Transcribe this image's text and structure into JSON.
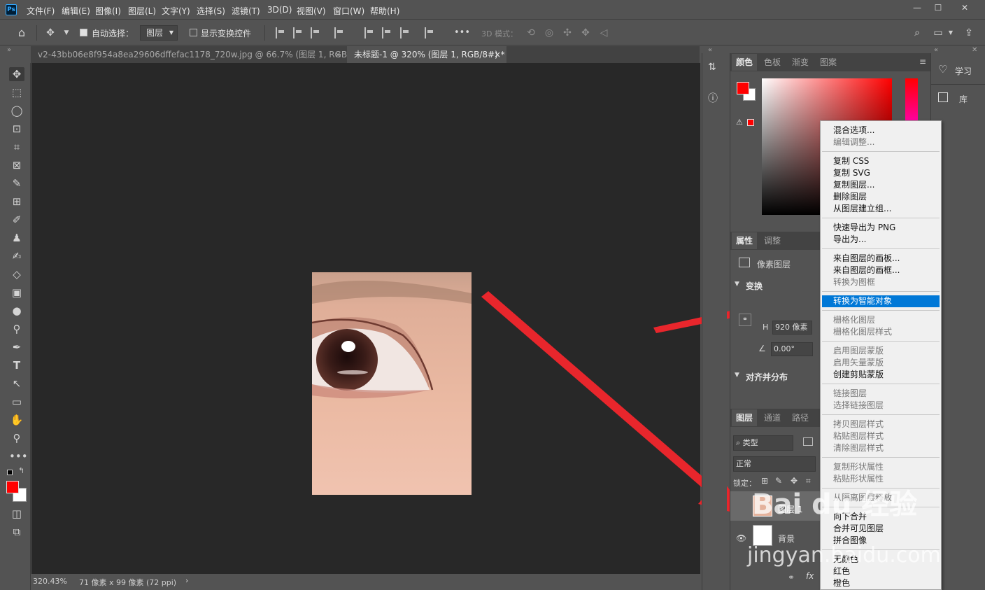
{
  "menubar": {
    "items": [
      "文件(F)",
      "编辑(E)",
      "图像(I)",
      "图层(L)",
      "文字(Y)",
      "选择(S)",
      "滤镜(T)",
      "3D(D)",
      "视图(V)",
      "窗口(W)",
      "帮助(H)"
    ],
    "app_logo": "Ps"
  },
  "optionsbar": {
    "auto_select_label": "自动选择：",
    "auto_select_target": "图层",
    "show_transform_label": "显示变换控件",
    "three_d_mode_label": "3D 模式：",
    "more": "•••"
  },
  "tabs": [
    {
      "label": "v2-43bb06e8f954a8ea29606dffefac1178_720w.jpg @ 66.7% (图层 1, RGB/8#) *",
      "close": "×"
    },
    {
      "label": "未标题-1 @ 320% (图层 1, RGB/8#) *",
      "close": "×"
    }
  ],
  "status": {
    "zoom": "320.43%",
    "doc_size": "71 像素 x 99 像素 (72 ppi)",
    "arrow": "›"
  },
  "color_panel": {
    "tabs": [
      "颜色",
      "色板",
      "渐变",
      "图案"
    ],
    "foreground": "#ff0000",
    "background": "#ffffff"
  },
  "properties_panel": {
    "tabs": [
      "属性",
      "调整"
    ],
    "layer_type": "像素图层",
    "transform_heading": "变换",
    "h_label": "H",
    "h_value": "920 像素",
    "angle_value": "0.00°",
    "align_heading": "对齐并分布"
  },
  "layers_panel": {
    "tabs": [
      "图层",
      "通道",
      "路径"
    ],
    "filter": "类型",
    "blend_mode": "正常",
    "lock_label": "锁定：",
    "layers": [
      {
        "name": "图层 1"
      },
      {
        "name": "背景"
      }
    ],
    "fx": "fx"
  },
  "side_panel": {
    "learn": "学习",
    "library": "库"
  },
  "context_menu": {
    "groups": [
      [
        {
          "label": "混合选项...",
          "state": "enabled"
        },
        {
          "label": "编辑调整...",
          "state": "disabled"
        }
      ],
      [
        {
          "label": "复制 CSS",
          "state": "enabled"
        },
        {
          "label": "复制 SVG",
          "state": "enabled"
        },
        {
          "label": "复制图层...",
          "state": "enabled"
        },
        {
          "label": "删除图层",
          "state": "enabled"
        },
        {
          "label": "从图层建立组...",
          "state": "enabled"
        }
      ],
      [
        {
          "label": "快速导出为 PNG",
          "state": "enabled"
        },
        {
          "label": "导出为...",
          "state": "enabled"
        }
      ],
      [
        {
          "label": "来自图层的画板...",
          "state": "enabled"
        },
        {
          "label": "来自图层的画框...",
          "state": "enabled"
        },
        {
          "label": "转换为图框",
          "state": "disabled"
        }
      ],
      [
        {
          "label": "转换为智能对象",
          "state": "selected"
        }
      ],
      [
        {
          "label": "栅格化图层",
          "state": "disabled"
        },
        {
          "label": "栅格化图层样式",
          "state": "disabled"
        }
      ],
      [
        {
          "label": "启用图层蒙版",
          "state": "disabled"
        },
        {
          "label": "启用矢量蒙版",
          "state": "disabled"
        },
        {
          "label": "创建剪贴蒙版",
          "state": "enabled"
        }
      ],
      [
        {
          "label": "链接图层",
          "state": "disabled"
        },
        {
          "label": "选择链接图层",
          "state": "disabled"
        }
      ],
      [
        {
          "label": "拷贝图层样式",
          "state": "disabled"
        },
        {
          "label": "粘贴图层样式",
          "state": "disabled"
        },
        {
          "label": "清除图层样式",
          "state": "disabled"
        }
      ],
      [
        {
          "label": "复制形状属性",
          "state": "disabled"
        },
        {
          "label": "粘贴形状属性",
          "state": "disabled"
        }
      ],
      [
        {
          "label": "从隔离图层释放",
          "state": "disabled"
        }
      ],
      [
        {
          "label": "向下合并",
          "state": "enabled"
        },
        {
          "label": "合并可见图层",
          "state": "enabled"
        },
        {
          "label": "拼合图像",
          "state": "enabled"
        }
      ],
      [
        {
          "label": "无颜色",
          "state": "enabled"
        },
        {
          "label": "红色",
          "state": "enabled"
        },
        {
          "label": "橙色",
          "state": "enabled"
        }
      ]
    ]
  },
  "watermark": {
    "line1": "Bai du 经验",
    "line2": "jingyan.baidu.com"
  },
  "colors": {
    "arrow": "#e8262c",
    "menu_highlight": "#0078d7"
  }
}
